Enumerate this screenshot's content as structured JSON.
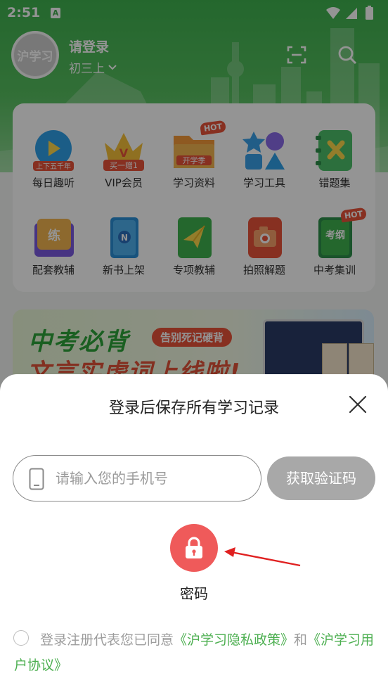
{
  "status_bar": {
    "time": "2:51",
    "notification_glyph": "A"
  },
  "header": {
    "avatar_text": "沪学习",
    "login_title": "请登录",
    "grade": "初三上",
    "icons": [
      "scan-icon",
      "search-icon"
    ]
  },
  "grid": {
    "items": [
      {
        "label": "每日趣听",
        "badge": "上下五千年",
        "icon": "play-icon"
      },
      {
        "label": "VIP会员",
        "badge": "买一赠1",
        "icon": "crown-icon"
      },
      {
        "label": "学习资料",
        "badge": "开学季",
        "icon": "folder-icon",
        "hot": "HOT"
      },
      {
        "label": "学习工具",
        "icon": "shapes-icon"
      },
      {
        "label": "错题集",
        "icon": "notebook-x-icon"
      },
      {
        "label": "配套教辅",
        "badge": "练",
        "icon": "book-practice-icon"
      },
      {
        "label": "新书上架",
        "icon": "new-book-icon"
      },
      {
        "label": "专项教辅",
        "icon": "paper-plane-book-icon"
      },
      {
        "label": "拍照解题",
        "icon": "camera-icon"
      },
      {
        "label": "中考集训",
        "badge": "考纲",
        "icon": "exam-book-icon",
        "hot": "HOT"
      }
    ]
  },
  "banner": {
    "title": "中考必背",
    "tag": "告别死记硬背",
    "subtitle": "文言实虚词上线啦!"
  },
  "sheet": {
    "title": "登录后保存所有学习记录",
    "phone_placeholder": "请输入您的手机号",
    "get_code": "获取验证码",
    "password_label": "密码",
    "agreement": {
      "prefix": "登录注册代表您已同意",
      "privacy_link": "《沪学习隐私政策》",
      "and": "和",
      "terms_link": "《沪学习用户协议》"
    }
  },
  "colors": {
    "brand_green": "#45ad52",
    "password_red": "#ef5a5a",
    "link_green": "#4caf50",
    "code_button_gray": "#a8a8a8",
    "arrow_red": "#e02020"
  }
}
